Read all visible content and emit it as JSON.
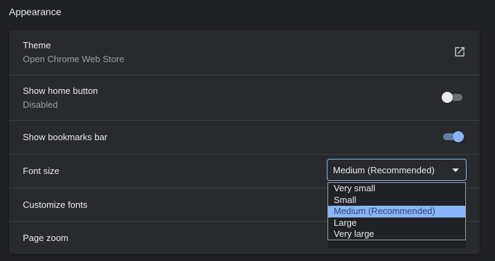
{
  "section": {
    "title": "Appearance"
  },
  "theme": {
    "label": "Theme",
    "sublabel": "Open Chrome Web Store",
    "icon": "open-in-new-icon"
  },
  "home_button": {
    "label": "Show home button",
    "sublabel": "Disabled",
    "enabled": false
  },
  "bookmarks_bar": {
    "label": "Show bookmarks bar",
    "enabled": true
  },
  "font_size": {
    "label": "Font size",
    "selected": "Medium (Recommended)",
    "options": [
      "Very small",
      "Small",
      "Medium (Recommended)",
      "Large",
      "Very large"
    ]
  },
  "customize_fonts": {
    "label": "Customize fonts"
  },
  "page_zoom": {
    "label": "Page zoom"
  },
  "colors": {
    "accent": "#8ab4f8",
    "background": "#202124",
    "card": "#292a2d"
  }
}
